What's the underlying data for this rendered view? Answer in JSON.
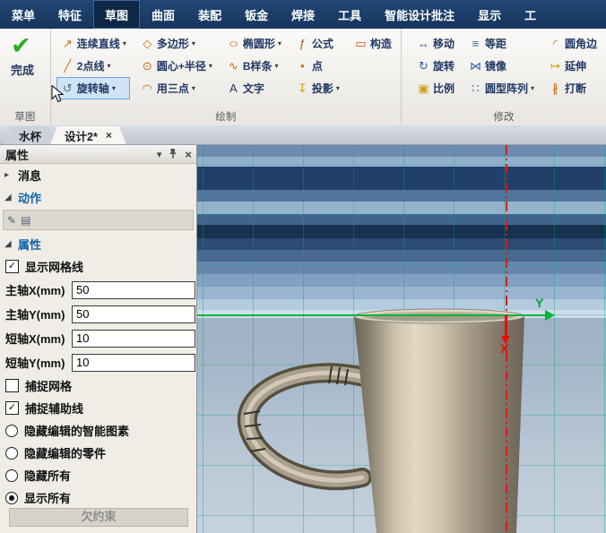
{
  "menubar": {
    "items": [
      {
        "label": "菜单"
      },
      {
        "label": "特征"
      },
      {
        "label": "草图",
        "active": true
      },
      {
        "label": "曲面"
      },
      {
        "label": "装配"
      },
      {
        "label": "钣金"
      },
      {
        "label": "焊接"
      },
      {
        "label": "工具"
      },
      {
        "label": "智能设计批注"
      },
      {
        "label": "显示"
      },
      {
        "label": "工"
      }
    ]
  },
  "ribbon": {
    "finish": {
      "label": "完成",
      "icon": "check-mark",
      "group_label": "草图"
    },
    "draw_group": {
      "label": "绘制",
      "columns": [
        [
          {
            "id": "polyline",
            "label": "连续直线",
            "icon": "↗",
            "icon_name": "polyline-icon",
            "color": "#c96a12",
            "dropdown": true
          },
          {
            "id": "two-point-line",
            "label": "2点线",
            "icon": "╱",
            "icon_name": "line-icon",
            "color": "#c96a12",
            "dropdown": true
          },
          {
            "id": "revolve-axis",
            "label": "旋转轴",
            "icon": "↺",
            "icon_name": "revolve-axis-icon",
            "color": "#5a6b7d",
            "dropdown": true,
            "active": true
          }
        ],
        [
          {
            "id": "polygon",
            "label": "多边形",
            "icon": "◇",
            "icon_name": "polygon-icon",
            "color": "#c96a12",
            "dropdown": true
          },
          {
            "id": "circle-center-radius",
            "label": "圆心+半径",
            "icon": "⊙",
            "icon_name": "circle-icon",
            "color": "#c96a12",
            "dropdown": true
          },
          {
            "id": "arc-three-point",
            "label": "用三点",
            "icon": "◠",
            "icon_name": "arc-icon",
            "color": "#c96a12",
            "dropdown": true
          }
        ],
        [
          {
            "id": "ellipse",
            "label": "椭圆形",
            "icon": "○",
            "icon_name": "ellipse-icon",
            "color": "#c96a12",
            "dropdown": true,
            "wide_icon": true
          },
          {
            "id": "bspline",
            "label": "B样条",
            "icon": "∿",
            "icon_name": "spline-icon",
            "color": "#c96a12",
            "dropdown": true
          },
          {
            "id": "text",
            "label": "文字",
            "icon": "A",
            "icon_name": "text-icon",
            "color": "#1f3864",
            "dropdown": false
          }
        ],
        [
          {
            "id": "formula",
            "label": "公式",
            "icon": "ƒ",
            "icon_name": "formula-icon",
            "color": "#b3541e",
            "dropdown": false
          },
          {
            "id": "point",
            "label": "点",
            "icon": "•",
            "icon_name": "point-icon",
            "color": "#c96a12",
            "dropdown": false
          },
          {
            "id": "projection",
            "label": "投影",
            "icon": "↧",
            "icon_name": "projection-icon",
            "color": "#c9a312",
            "dropdown": true
          }
        ],
        [
          {
            "id": "construction",
            "label": "构造",
            "icon": "▭",
            "icon_name": "construction-icon",
            "color": "#c94a12",
            "dropdown": false
          }
        ]
      ]
    },
    "modify_group": {
      "label": "修改",
      "columns": [
        [
          {
            "id": "move",
            "label": "移动",
            "icon": "↔",
            "icon_name": "move-icon",
            "color": "#2f5fa8",
            "dropdown": false
          },
          {
            "id": "rotate",
            "label": "旋转",
            "icon": "↻",
            "icon_name": "rotate-icon",
            "color": "#2f5fa8",
            "dropdown": false
          },
          {
            "id": "scale",
            "label": "比例",
            "icon": "▣",
            "icon_name": "scale-icon",
            "color": "#c9a312",
            "dropdown": false
          }
        ],
        [
          {
            "id": "offset",
            "label": "等距",
            "icon": "≡",
            "icon_name": "offset-icon",
            "color": "#2f5fa8",
            "dropdown": false
          },
          {
            "id": "mirror",
            "label": "镜像",
            "icon": "⋈",
            "icon_name": "mirror-icon",
            "color": "#2f5fa8",
            "dropdown": false
          },
          {
            "id": "circular-pattern",
            "label": "圆型阵列",
            "icon": "∷",
            "icon_name": "circular-pattern-icon",
            "color": "#2f5fa8",
            "dropdown": true
          }
        ],
        [
          {
            "id": "fillet-edge",
            "label": "圆角边",
            "icon": "◜",
            "icon_name": "fillet-icon",
            "color": "#c96a12",
            "dropdown": false
          },
          {
            "id": "extend",
            "label": "延伸",
            "icon": "↦",
            "icon_name": "extend-icon",
            "color": "#c9a312",
            "dropdown": false
          },
          {
            "id": "break",
            "label": "打断",
            "icon": "∦",
            "icon_name": "break-icon",
            "color": "#c96a12",
            "dropdown": false
          }
        ]
      ]
    }
  },
  "doc_tabs": [
    {
      "label": "水杯",
      "active": false
    },
    {
      "label": "设计2*",
      "active": true,
      "close_label": "×"
    }
  ],
  "panel": {
    "title": "属性",
    "message_label": "消息",
    "action_label": "动作",
    "property_label": "属性",
    "rows": [
      {
        "id": "display-gridlines",
        "type": "checkbox",
        "label": "显示网格线",
        "checked": true
      },
      {
        "id": "major-axis-x",
        "type": "field",
        "label": "主轴X(mm)",
        "value": "50"
      },
      {
        "id": "major-axis-y",
        "type": "field",
        "label": "主轴Y(mm)",
        "value": "50"
      },
      {
        "id": "minor-axis-x",
        "type": "field",
        "label": "短轴X(mm)",
        "value": "10"
      },
      {
        "id": "minor-axis-y",
        "type": "field",
        "label": "短轴Y(mm)",
        "value": "10"
      },
      {
        "id": "snap-grid",
        "type": "checkbox",
        "label": "捕捉网格",
        "checked": false
      },
      {
        "id": "snap-guidelines",
        "type": "checkbox",
        "label": "捕捉辅助线",
        "checked": true
      },
      {
        "id": "hide-edited-smart-elements",
        "type": "radio",
        "label": "隐藏编辑的智能图素",
        "checked": false
      },
      {
        "id": "hide-edited-parts",
        "type": "radio",
        "label": "隐藏编辑的零件",
        "checked": false
      },
      {
        "id": "hide-all",
        "type": "radio",
        "label": "隐藏所有",
        "checked": false
      },
      {
        "id": "show-all",
        "type": "radio",
        "label": "显示所有",
        "checked": true
      }
    ],
    "footer_button": "欠约束"
  },
  "viewport": {
    "y_axis_label": "Y",
    "x_axis_label": "X",
    "y_axis_color": "#00b43c",
    "x_axis_color": "#ea0c0c",
    "centerline_color": "#e01818",
    "grid_color": "#00a57d"
  }
}
